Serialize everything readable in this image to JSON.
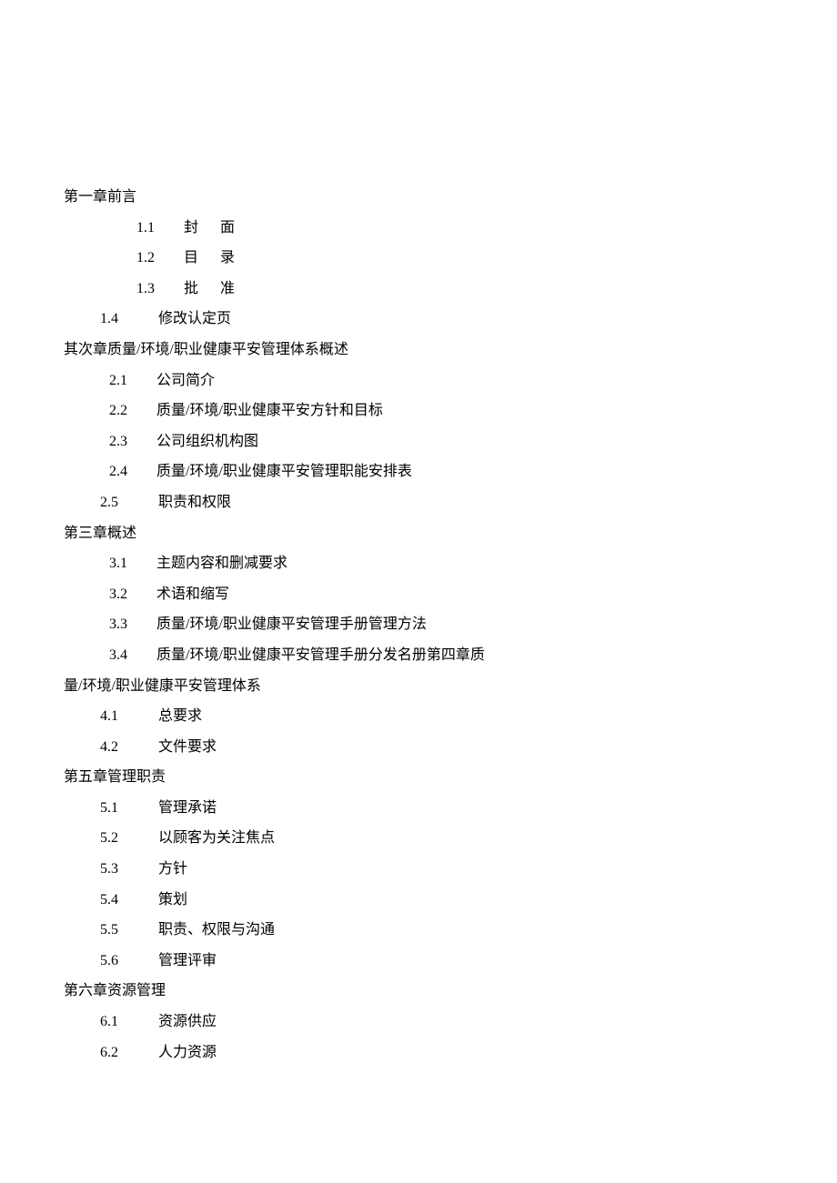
{
  "chapters": [
    {
      "title": "第一章前言",
      "items": [
        {
          "num": "1.1",
          "text": "封面",
          "spaced": true,
          "deep": true
        },
        {
          "num": "1.2",
          "text": "目录",
          "spaced": true,
          "deep": true
        },
        {
          "num": "1.3",
          "text": "批准",
          "spaced": true,
          "deep": true
        },
        {
          "num": "1.4",
          "text": "修改认定页",
          "spaced": false,
          "deep": false
        }
      ]
    },
    {
      "title": "其次章质量/环境/职业健康平安管理体系概述",
      "items": [
        {
          "num": "2.1",
          "text": "公司简介"
        },
        {
          "num": "2.2",
          "text": "质量/环境/职业健康平安方针和目标"
        },
        {
          "num": "2.3",
          "text": "公司组织机构图"
        },
        {
          "num": "2.4",
          "text": "质量/环境/职业健康平安管理职能安排表"
        },
        {
          "num": "2.5",
          "text": "职责和权限",
          "shallow": true
        }
      ]
    },
    {
      "title": "第三章概述",
      "items": [
        {
          "num": "3.1",
          "text": "主题内容和删减要求"
        },
        {
          "num": "3.2",
          "text": "术语和缩写"
        },
        {
          "num": "3.3",
          "text": "质量/环境/职业健康平安管理手册管理方法"
        },
        {
          "num": "3.4",
          "text": "质量/环境/职业健康平安管理手册分发名册第四章质"
        }
      ],
      "continuation": "量/环境/职业健康平安管理体系",
      "extra_items": [
        {
          "num": "4.1",
          "text": "总要求",
          "shallow": true
        },
        {
          "num": "4.2",
          "text": "文件要求",
          "shallow": true
        }
      ]
    },
    {
      "title": "第五章管理职责",
      "items": [
        {
          "num": "5.1",
          "text": "管理承诺",
          "shallow": true
        },
        {
          "num": "5.2",
          "text": "以顾客为关注焦点",
          "shallow": true
        },
        {
          "num": "5.3",
          "text": "方针",
          "shallow": true
        },
        {
          "num": "5.4",
          "text": "策划",
          "shallow": true
        },
        {
          "num": "5.5",
          "text": "职责、权限与沟通",
          "shallow": true
        },
        {
          "num": "5.6",
          "text": "管理评审",
          "shallow": true
        }
      ]
    },
    {
      "title": "第六章资源管理",
      "items": [
        {
          "num": "6.1",
          "text": "资源供应",
          "shallow": true
        },
        {
          "num": "6.2",
          "text": "人力资源",
          "shallow": true
        }
      ]
    }
  ]
}
